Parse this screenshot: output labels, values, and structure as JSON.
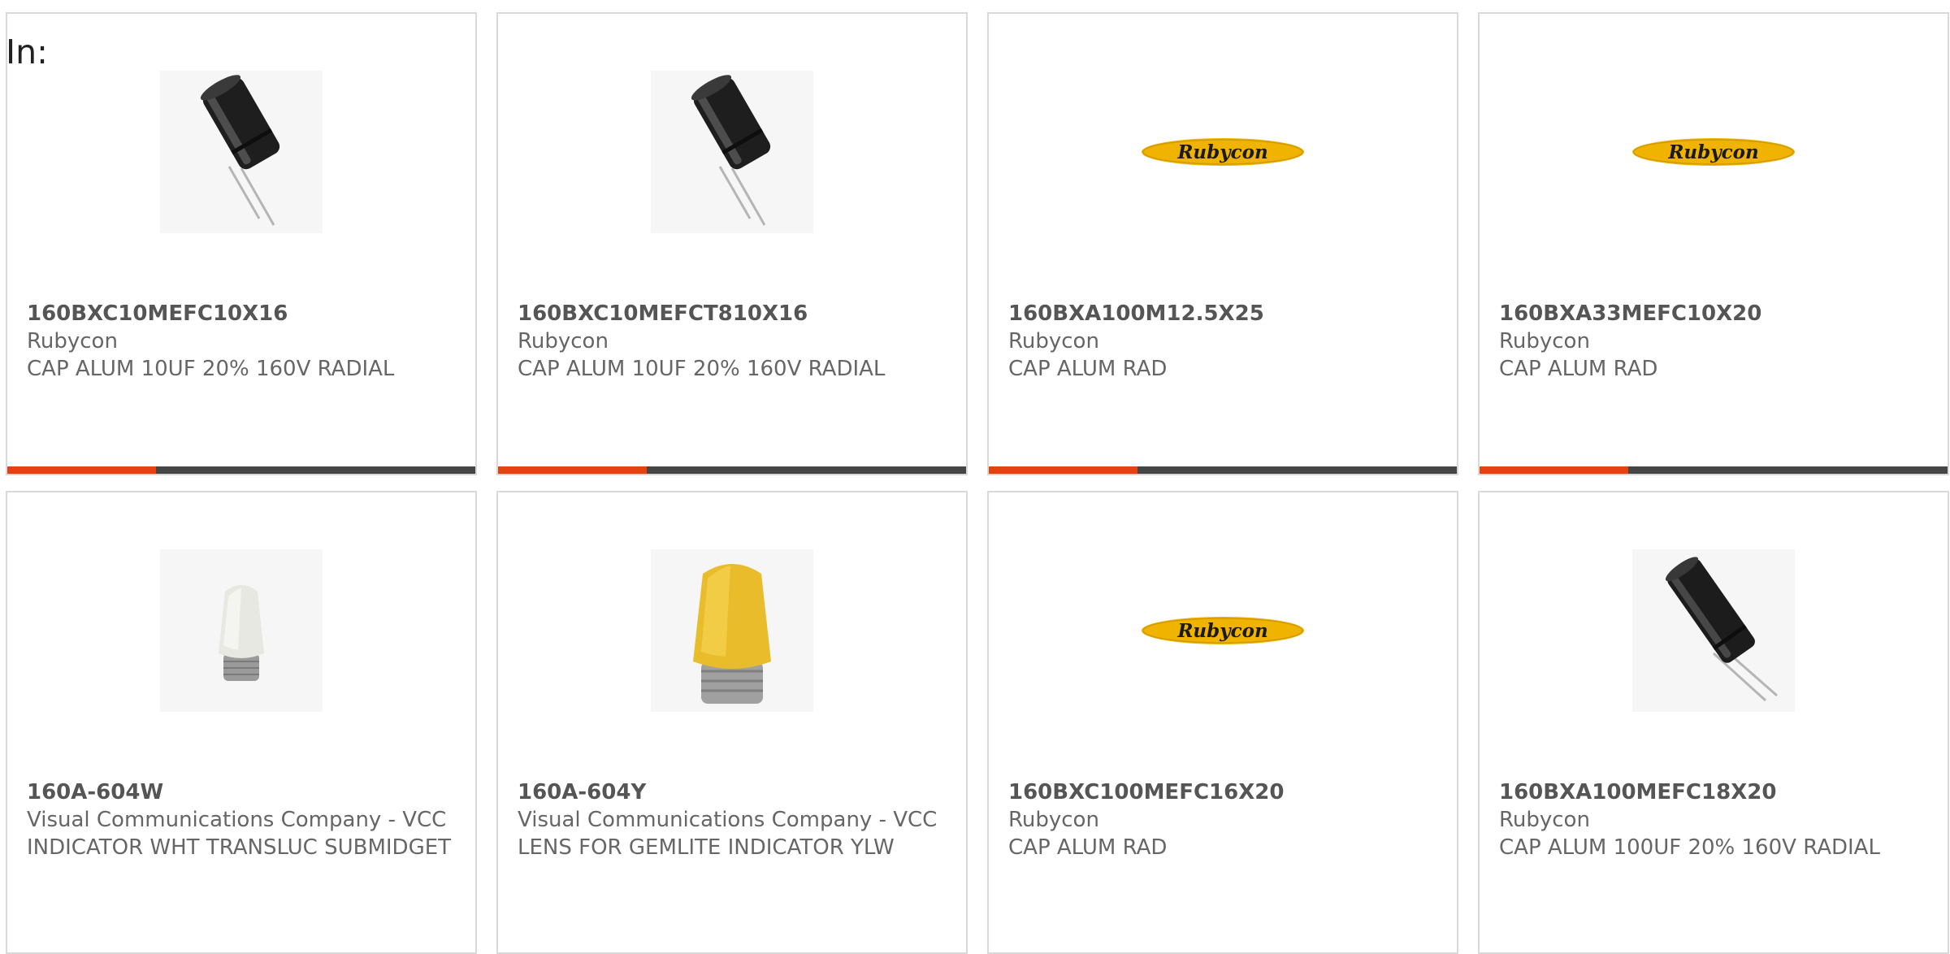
{
  "header": {
    "in_label": "In:"
  },
  "accent_color": "#e5420f",
  "cards": [
    {
      "part_number": "160BXC10MEFC10X16",
      "manufacturer": "Rubycon",
      "description": "CAP ALUM 10UF 20% 160V RADIAL",
      "image": "capacitor-photo"
    },
    {
      "part_number": "160BXC10MEFCT810X16",
      "manufacturer": "Rubycon",
      "description": "CAP ALUM 10UF 20% 160V RADIAL",
      "image": "capacitor-photo"
    },
    {
      "part_number": "160BXA100M12.5X25",
      "manufacturer": "Rubycon",
      "description": "CAP ALUM RAD",
      "image": "rubycon-logo",
      "logo_text": "Rubycon"
    },
    {
      "part_number": "160BXA33MEFC10X20",
      "manufacturer": "Rubycon",
      "description": "CAP ALUM RAD",
      "image": "rubycon-logo",
      "logo_text": "Rubycon"
    },
    {
      "part_number": "160A-604W",
      "manufacturer": "Visual Communications Company - VCC",
      "description": "INDICATOR WHT TRANSLUC SUBMIDGET",
      "image": "white-lens-photo"
    },
    {
      "part_number": "160A-604Y",
      "manufacturer": "Visual Communications Company - VCC",
      "description": "LENS FOR GEMLITE INDICATOR YLW",
      "image": "yellow-lens-photo"
    },
    {
      "part_number": "160BXC100MEFC16X20",
      "manufacturer": "Rubycon",
      "description": "CAP ALUM RAD",
      "image": "rubycon-logo",
      "logo_text": "Rubycon"
    },
    {
      "part_number": "160BXA100MEFC18X20",
      "manufacturer": "Rubycon",
      "description": "CAP ALUM 100UF 20% 160V RADIAL",
      "image": "capacitor-photo"
    }
  ]
}
